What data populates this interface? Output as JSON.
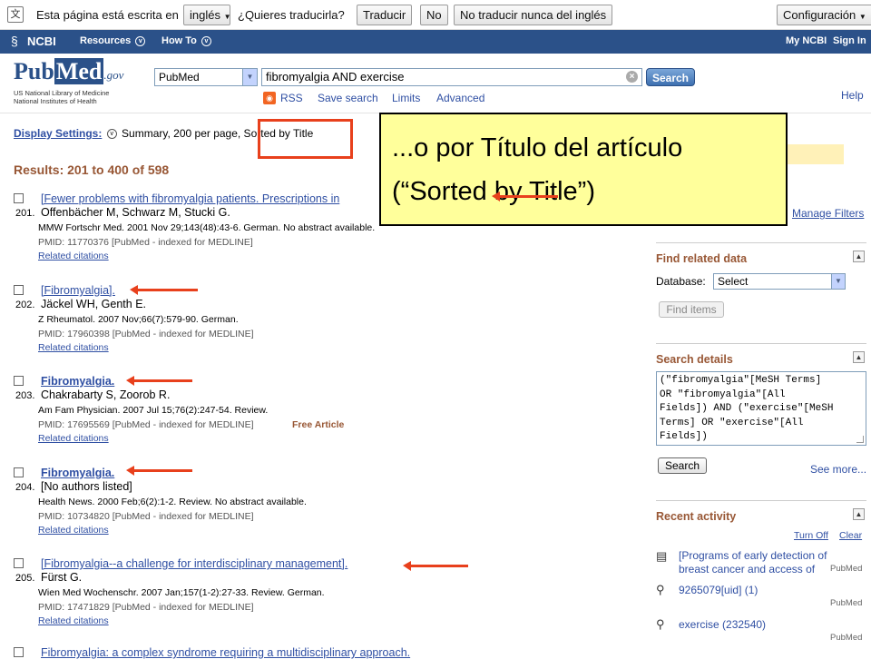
{
  "translate_bar": {
    "prompt": "Esta página está escrita en",
    "language": "inglés",
    "question": "¿Quieres traducirla?",
    "translate_btn": "Traducir",
    "no_btn": "No",
    "never_btn": "No traducir nunca del inglés",
    "settings_btn": "Configuración"
  },
  "ncbi_bar": {
    "logo": "NCBI",
    "resources": "Resources",
    "howto": "How To",
    "myncbi": "My NCBI",
    "signin": "Sign In"
  },
  "header": {
    "logo_pub": "Pub",
    "logo_med": "Med",
    "logo_gov": ".gov",
    "logo_sub1": "US National Library of Medicine",
    "logo_sub2": "National Institutes of Health",
    "database": "PubMed",
    "query": "fibromyalgia AND exercise",
    "search_btn": "Search",
    "rss": "RSS",
    "save_search": "Save search",
    "limits": "Limits",
    "advanced": "Advanced",
    "help": "Help"
  },
  "display": {
    "label": "Display Settings:",
    "value": "Summary, 200 per page, Sorted by Title"
  },
  "results_heading": "Results: 201 to 400 of 598",
  "results": [
    {
      "num": "201.",
      "title": "[Fewer problems with fibromyalgia patients. Prescriptions in",
      "authors": "Offenbächer M, Schwarz M, Stucki G.",
      "journal": "MMW Fortschr Med. 2001 Nov 29;143(48):43-6. German. No abstract available.",
      "pmid": "PMID: 11770376 [PubMed - indexed for MEDLINE]",
      "related": "Related citations",
      "free": ""
    },
    {
      "num": "202.",
      "title": "[Fibromyalgia].",
      "authors": "Jäckel WH, Genth E.",
      "journal": "Z Rheumatol. 2007 Nov;66(7):579-90. German.",
      "pmid": "PMID: 17960398 [PubMed - indexed for MEDLINE]",
      "related": "Related citations",
      "free": ""
    },
    {
      "num": "203.",
      "title": "Fibromyalgia.",
      "authors": "Chakrabarty S, Zoorob R.",
      "journal": "Am Fam Physician. 2007 Jul 15;76(2):247-54. Review.",
      "pmid": "PMID: 17695569 [PubMed - indexed for MEDLINE]",
      "related": "Related citations",
      "free": "Free Article"
    },
    {
      "num": "204.",
      "title": "Fibromyalgia.",
      "authors": "[No authors listed]",
      "journal": "Health News. 2000 Feb;6(2):1-2. Review. No abstract available.",
      "pmid": "PMID: 10734820 [PubMed - indexed for MEDLINE]",
      "related": "Related citations",
      "free": ""
    },
    {
      "num": "205.",
      "title": "[Fibromyalgia--a challenge for interdisciplinary management].",
      "authors": "Fürst G.",
      "journal": "Wien Med Wochenschr. 2007 Jan;157(1-2):27-33. Review. German.",
      "pmid": "PMID: 17471829 [PubMed - indexed for MEDLINE]",
      "related": "Related citations",
      "free": ""
    }
  ],
  "partial_next_title": "Fibromyalgia: a complex syndrome requiring a multidisciplinary approach.",
  "sidebar": {
    "manage_filters": "Manage Filters",
    "find_related": {
      "title": "Find related data",
      "db_label": "Database:",
      "db_value": "Select",
      "find_btn": "Find items"
    },
    "search_details": {
      "title": "Search details",
      "query": "(\"fibromyalgia\"[MeSH Terms]\nOR \"fibromyalgia\"[All\nFields]) AND (\"exercise\"[MeSH\nTerms] OR \"exercise\"[All\nFields])",
      "search_btn": "Search",
      "see_more": "See more..."
    },
    "recent_activity": {
      "title": "Recent activity",
      "turn_off": "Turn Off",
      "clear": "Clear",
      "items": [
        {
          "text": "[Programs of early detection of breast cancer and access of",
          "source": "PubMed",
          "icon": "document-icon"
        },
        {
          "text": "9265079[uid] (1)",
          "source": "PubMed",
          "icon": "search-icon"
        },
        {
          "text": "exercise (232540)",
          "source": "PubMed",
          "icon": "search-icon"
        }
      ]
    }
  },
  "callout": {
    "line1": "...o por Título del artículo",
    "line2": "(“Sorted by Title”)"
  },
  "colors": {
    "ncbi_bar": "#2b5189",
    "link": "#2f4fa3",
    "heading": "#985735",
    "callout_bg": "#ffff9b",
    "annotation_red": "#e8401c"
  }
}
